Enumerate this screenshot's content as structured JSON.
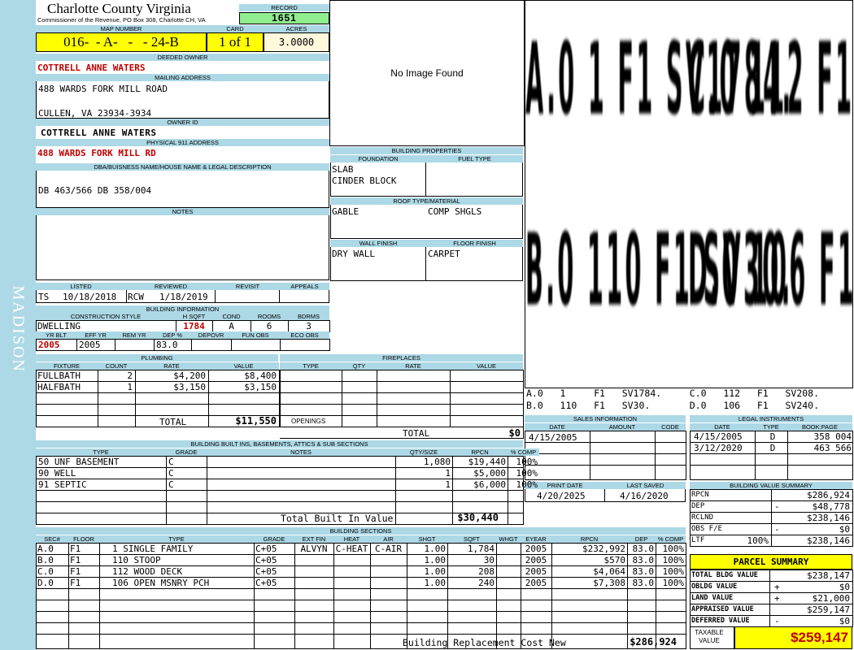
{
  "side_label": "MADISON",
  "county": {
    "name": "Charlotte County Virginia",
    "subtitle": "Commissioner of the Revenue, PO Box 308, Charlotte CH, VA"
  },
  "record": {
    "label": "RECORD",
    "value": "1651"
  },
  "map": {
    "label": "MAP NUMBER",
    "value": "016-  - A-   -   - 24-B"
  },
  "card": {
    "label": "CARD",
    "value": "1 of 1"
  },
  "acres": {
    "label": "ACRES",
    "value": "3.0000"
  },
  "deeded_owner": {
    "label": "DEEDED OWNER",
    "value": "COTTRELL ANNE WATERS"
  },
  "mailing": {
    "label": "MAILING ADDRESS",
    "line1": "488 WARDS FORK MILL ROAD",
    "line2": "CULLEN, VA 23934-3934"
  },
  "owner_id": {
    "label": "OWNER ID",
    "value": "COTTRELL ANNE WATERS"
  },
  "physical": {
    "label": "PHYSICAL 911 ADDRESS",
    "value": "488 WARDS FORK MILL RD"
  },
  "dba": {
    "label": "DBA/BUISNESS NAME/HOUSE NAME & LEGAL DESCRIPTION",
    "value": "DB 463/566 DB 358/004"
  },
  "notes": {
    "label": "NOTES"
  },
  "image": {
    "text": "No Image Found"
  },
  "listed": {
    "label": "LISTED",
    "by": "TS",
    "date": "10/18/2018"
  },
  "reviewed": {
    "label": "REVIEWED",
    "by": "RCW",
    "date": "1/18/2019"
  },
  "revisit": {
    "label": "REVISIT"
  },
  "appeals": {
    "label": "APPEALS"
  },
  "building_properties": {
    "label": "BUILDING PROPERTIES",
    "foundation_label": "FOUNDATION",
    "foundation1": "SLAB",
    "foundation2": "CINDER BLOCK",
    "fuel_label": "FUEL TYPE",
    "roof_label": "ROOF TYPE/MATERIAL",
    "roof_type": "GABLE",
    "roof_material": "COMP SHGLS",
    "wall_label": "WALL FINISH",
    "wall": "DRY WALL",
    "floor_label": "FLOOR FINISH",
    "floor": "CARPET"
  },
  "building_info": {
    "label": "BUILDING INFORMATION",
    "cols1": [
      "CONSTRUCTION STYLE",
      "H SQFT",
      "COND",
      "ROOMS",
      "BDRMS"
    ],
    "vals1": [
      "DWELLING",
      "1784",
      "A",
      "6",
      "3"
    ],
    "cols2": [
      "YR BLT",
      "EFF YR",
      "REM YR",
      "DEP %",
      "DEPOVR",
      "FUN OBS",
      "ECO OBS"
    ],
    "vals2": [
      "2005",
      "2005",
      "",
      "83.0",
      "",
      "",
      ""
    ]
  },
  "plumbing": {
    "label": "PLUMBING",
    "cols": [
      "FIXTURE",
      "COUNT",
      "RATE",
      "VALUE"
    ],
    "rows": [
      [
        "FULLBATH",
        "2",
        "$4,200",
        "$8,400"
      ],
      [
        "HALFBATH",
        "1",
        "$3,150",
        "$3,150"
      ]
    ],
    "total_label": "TOTAL",
    "total": "$11,550"
  },
  "fireplaces": {
    "label": "FIREPLACES",
    "cols": [
      "TYPE",
      "QTY",
      "RATE",
      "VALUE"
    ],
    "openings_label": "OPENINGS",
    "total_label": "TOTAL",
    "total": "$0"
  },
  "sketch": {
    "labels": [
      "A.0  1   F1  SV1784.",
      "C.0  112  F1  SV208.",
      "B.0  110  F1  SV30.",
      "D.0  106  F1  SV240."
    ],
    "legend1": "A.0   1     F1   SV1784.     C.0   112   F1   SV208.",
    "legend2": "B.0   110   F1   SV30.       D.0   106   F1   SV240."
  },
  "sales": {
    "label": "SALES INFORMATION",
    "cols": [
      "DATE",
      "AMOUNT",
      "CODE"
    ],
    "rows": [
      [
        "4/15/2005",
        "",
        ""
      ]
    ]
  },
  "legal": {
    "label": "LEGAL INSTRUMENTS",
    "cols": [
      "DATE",
      "TYPE",
      "BOOK:PAGE"
    ],
    "rows": [
      [
        "4/15/2005",
        "D",
        "358 004"
      ],
      [
        "3/12/2020",
        "D",
        "463 566"
      ]
    ]
  },
  "print": {
    "label": "PRINT DATE",
    "value": "4/20/2025"
  },
  "saved": {
    "label": "LAST SAVED",
    "value": "4/16/2020"
  },
  "built_ins": {
    "label": "BUILDING BUILT INS, BASEMENTS, ATTICS & SUB SECTIONS",
    "cols": [
      "TYPE",
      "GRADE",
      "NOTES",
      "QTY/SIZE",
      "RPCN",
      "% COMP"
    ],
    "rows": [
      [
        "50 UNF BASEMENT",
        "C",
        "",
        "1,080",
        "$19,440",
        "100%"
      ],
      [
        "90 WELL",
        "C",
        "",
        "1",
        "$5,000",
        "100%"
      ],
      [
        "91 SEPTIC",
        "C",
        "",
        "1",
        "$6,000",
        "100%"
      ]
    ],
    "total_label": "Total Built In Value",
    "total": "$30,440"
  },
  "value_summary": {
    "label": "BUILDING VALUE SUMMARY",
    "rows": [
      {
        "k": "RPCN",
        "pct": "",
        "sign": "",
        "v": "$286,924"
      },
      {
        "k": "DEP",
        "pct": "",
        "sign": "-",
        "v": "$48,778"
      },
      {
        "k": "RCLND",
        "pct": "",
        "sign": "",
        "v": "$238,146"
      },
      {
        "k": "OBS F/E",
        "pct": "",
        "sign": "-",
        "v": "$0"
      },
      {
        "k": "LTF",
        "pct": "100%",
        "sign": "",
        "v": "$238,146"
      }
    ]
  },
  "sections": {
    "label": "BUILDING SECTIONS",
    "cols": [
      "SEC#",
      "FLOOR",
      "TYPE",
      "GRADE",
      "EXT FIN",
      "HEAT",
      "AIR",
      "SHGT",
      "SQFT",
      "WHGT",
      "EYEAR",
      "RPCN",
      "DEP",
      "% COMP"
    ],
    "rows": [
      [
        "A.0",
        "F1",
        "1 SINGLE FAMILY",
        "C+05",
        "ALVYN",
        "C-HEAT",
        "C-AIR",
        "1.00",
        "1,784",
        "",
        "2005",
        "$232,992",
        "83.0",
        "100%"
      ],
      [
        "B.0",
        "F1",
        "110 STOOP",
        "C+05",
        "",
        "",
        "",
        "1.00",
        "30",
        "",
        "2005",
        "$570",
        "83.0",
        "100%"
      ],
      [
        "C.0",
        "F1",
        "112 WOOD DECK",
        "C+05",
        "",
        "",
        "",
        "1.00",
        "208",
        "",
        "2005",
        "$4,064",
        "83.0",
        "100%"
      ],
      [
        "D.0",
        "F1",
        "106 OPEN MSNRY PCH",
        "C+05",
        "",
        "",
        "",
        "1.00",
        "240",
        "",
        "2005",
        "$7,308",
        "83.0",
        "100%"
      ]
    ],
    "total_label": "Building Replacement Cost New",
    "total": "$286,924"
  },
  "parcel": {
    "label": "PARCEL SUMMARY",
    "rows": [
      {
        "k": "TOTAL BLDG VALUE",
        "sign": "",
        "v": "$238,147"
      },
      {
        "k": "OBLDG VALUE",
        "sign": "+",
        "v": "$0"
      },
      {
        "k": "LAND VALUE",
        "sign": "+",
        "v": "$21,000"
      },
      {
        "k": "APPRAISED VALUE",
        "sign": "",
        "v": "$259,147"
      },
      {
        "k": "DEFERRED VALUE",
        "sign": "-",
        "v": "$0"
      }
    ],
    "taxable_label": "TAXABLE VALUE",
    "taxable": "$259,147"
  }
}
